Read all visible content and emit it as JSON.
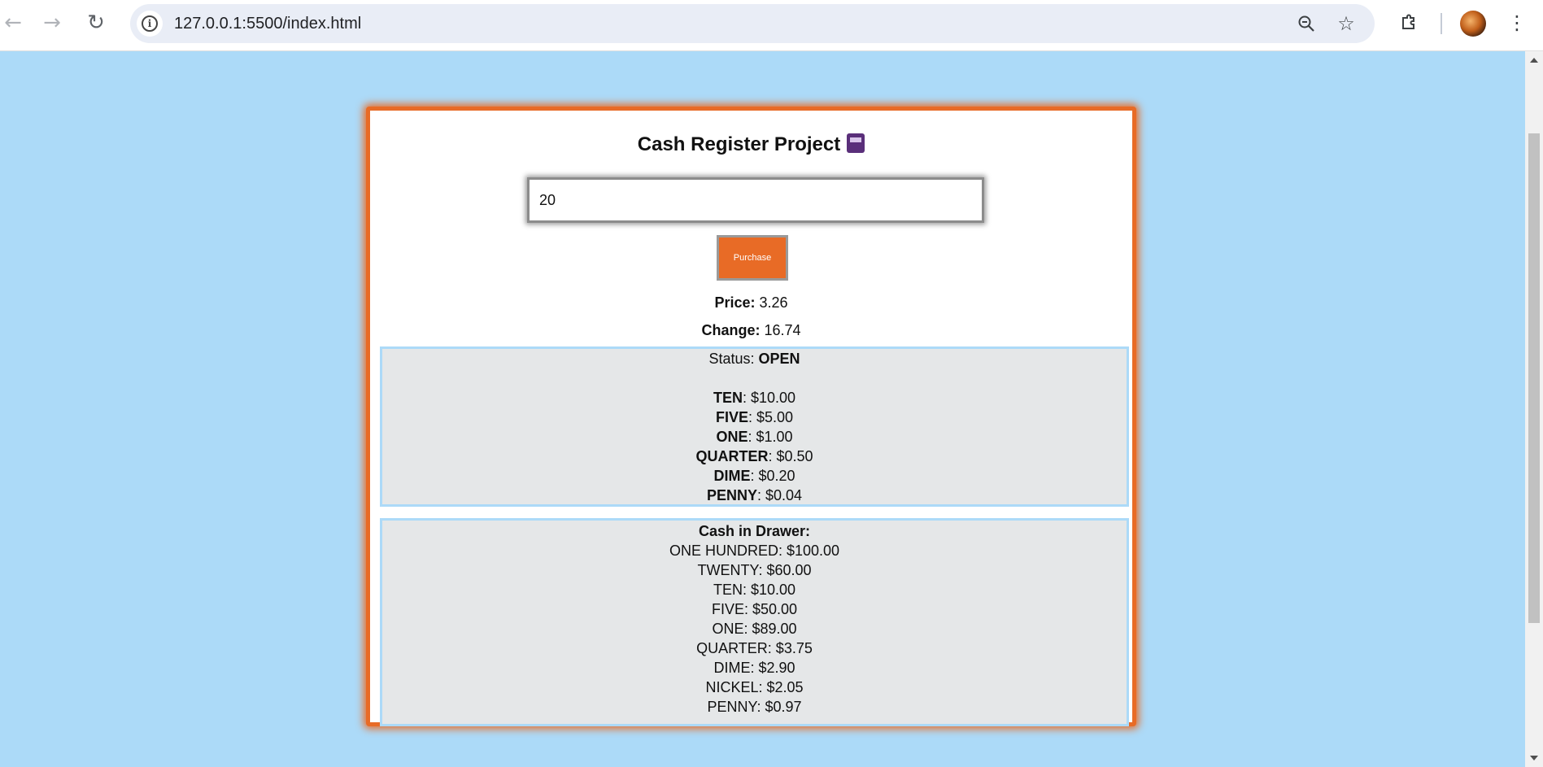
{
  "browser": {
    "url": "127.0.0.1:5500/index.html",
    "back_icon": "arrow-left-icon",
    "forward_icon": "arrow-right-icon",
    "reload_icon": "reload-icon",
    "site_info_icon": "info-icon",
    "zoom_icon": "zoom-out-icon",
    "bookmark_icon": "star-icon",
    "extensions_icon": "puzzle-icon",
    "menu_icon": "kebab-menu-icon"
  },
  "page": {
    "title": "Cash Register Project",
    "title_emoji": "fax-machine-icon",
    "cash_input_value": "20",
    "purchase_label": "Purchase",
    "price_label": "Price:",
    "price_value": "3.26",
    "change_label": "Change:",
    "change_value": "16.74",
    "status": {
      "label": "Status:",
      "value": "OPEN",
      "items": [
        {
          "name": "TEN",
          "amount": ": $10.00"
        },
        {
          "name": "FIVE",
          "amount": ": $5.00"
        },
        {
          "name": "ONE",
          "amount": ": $1.00"
        },
        {
          "name": "QUARTER",
          "amount": ": $0.50"
        },
        {
          "name": "DIME",
          "amount": ": $0.20"
        },
        {
          "name": "PENNY",
          "amount": ": $0.04"
        }
      ]
    },
    "drawer": {
      "heading": "Cash in Drawer:",
      "items": [
        "ONE HUNDRED: $100.00",
        "TWENTY: $60.00",
        "TEN: $10.00",
        "FIVE: $50.00",
        "ONE: $89.00",
        "QUARTER: $3.75",
        "DIME: $2.90",
        "NICKEL: $2.05",
        "PENNY: $0.97"
      ]
    }
  },
  "colors": {
    "background": "#acdaf8",
    "accent": "#e86b26",
    "panel": "#e5e7e8"
  }
}
